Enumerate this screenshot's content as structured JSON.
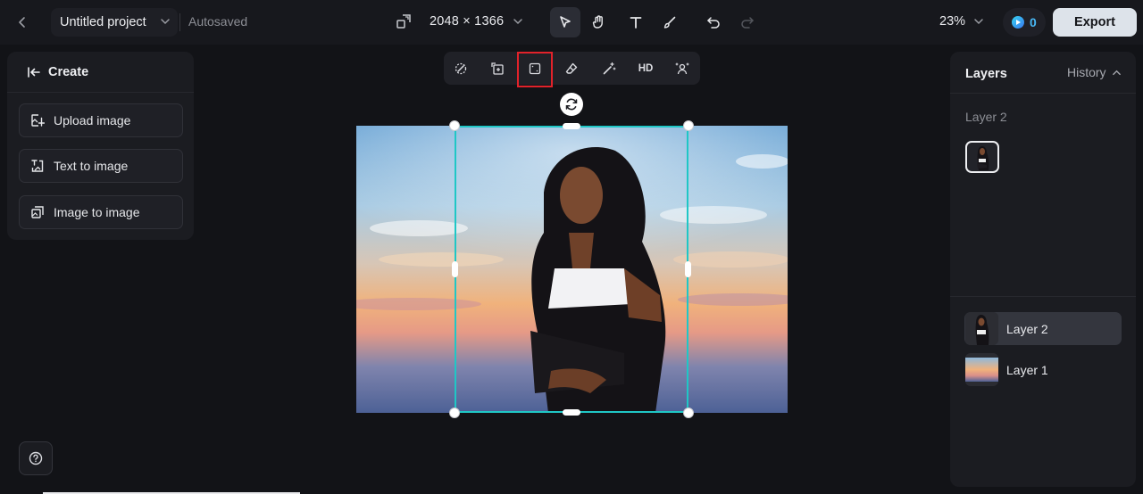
{
  "topbar": {
    "project_name": "Untitled project",
    "save_status": "Autosaved",
    "canvas_size": "2048 × 1366",
    "zoom": "23%",
    "credits": "0",
    "export_label": "Export"
  },
  "left_panel": {
    "title": "Create",
    "buttons": [
      {
        "label": "Upload image",
        "icon": "upload-image-icon"
      },
      {
        "label": "Text to image",
        "icon": "text-to-image-icon"
      },
      {
        "label": "Image to image",
        "icon": "image-to-image-icon"
      }
    ]
  },
  "floating_toolbar": {
    "tools": [
      "magic-remove-icon",
      "crop-frame-icon",
      "select-area-icon",
      "eraser-icon",
      "magic-wand-icon",
      "HD",
      "retouch-person-icon"
    ],
    "hd_label": "HD",
    "highlighted_tool": "select-area-icon"
  },
  "right_panel": {
    "tab_layers": "Layers",
    "tab_history": "History",
    "selected_layer_title": "Layer 2",
    "layers": [
      {
        "name": "Layer 2",
        "selected": true
      },
      {
        "name": "Layer 1",
        "selected": false
      }
    ]
  },
  "colors": {
    "accent_selection": "#1fc7c6",
    "highlight_box": "#e1222a",
    "export_button": "#dde3ea",
    "credits_accent": "#48b8f5"
  }
}
